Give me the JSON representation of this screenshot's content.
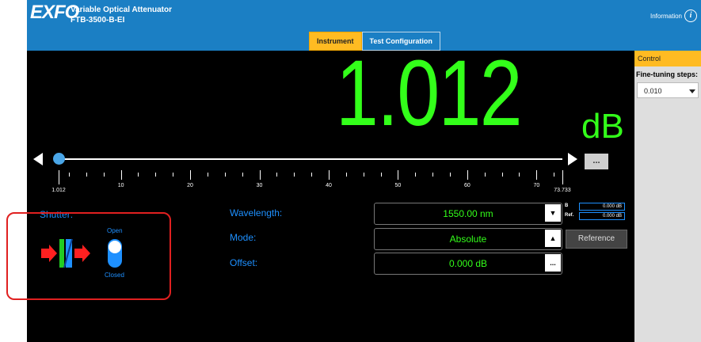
{
  "header": {
    "logo": "EXFO",
    "product_name": "Variable Optical Attenuator",
    "product_model": "FTB-3500-B-EI",
    "info_label": "Information",
    "info_icon": "info-icon"
  },
  "tabs": [
    {
      "label": "Instrument",
      "active": true
    },
    {
      "label": "Test Configuration",
      "active": false
    }
  ],
  "reading": {
    "value": "1.012",
    "unit": "dB"
  },
  "slider": {
    "value": 1.012,
    "min": 1.012,
    "max": 73.733,
    "more_label": "...",
    "tick_labels": [
      "1.012",
      "10",
      "20",
      "30",
      "40",
      "50",
      "60",
      "70",
      "73.733"
    ]
  },
  "shutter": {
    "label": "Shutter:",
    "open_label": "Open",
    "closed_label": "Closed",
    "state": "closed"
  },
  "fields": {
    "wavelength": {
      "label": "Wavelength:",
      "value": "1550.00 nm"
    },
    "mode": {
      "label": "Mode:",
      "value": "Absolute"
    },
    "offset": {
      "label": "Offset:",
      "value": "0.000 dB",
      "button": "..."
    }
  },
  "b_ref": {
    "b_label": "B",
    "b_value": "0.000 dB",
    "ref_label": "Ref.",
    "ref_value": "0.000 dB"
  },
  "reference_button": "Reference",
  "control_panel": {
    "title": "Control",
    "fine_tuning_label": "Fine-tuning steps:",
    "fine_tuning_value": "0.010"
  },
  "colors": {
    "header": "#1b7fc4",
    "accent": "#ffbb22",
    "reading": "#33ff1a",
    "label": "#1e90ff",
    "highlight": "#e02020"
  }
}
